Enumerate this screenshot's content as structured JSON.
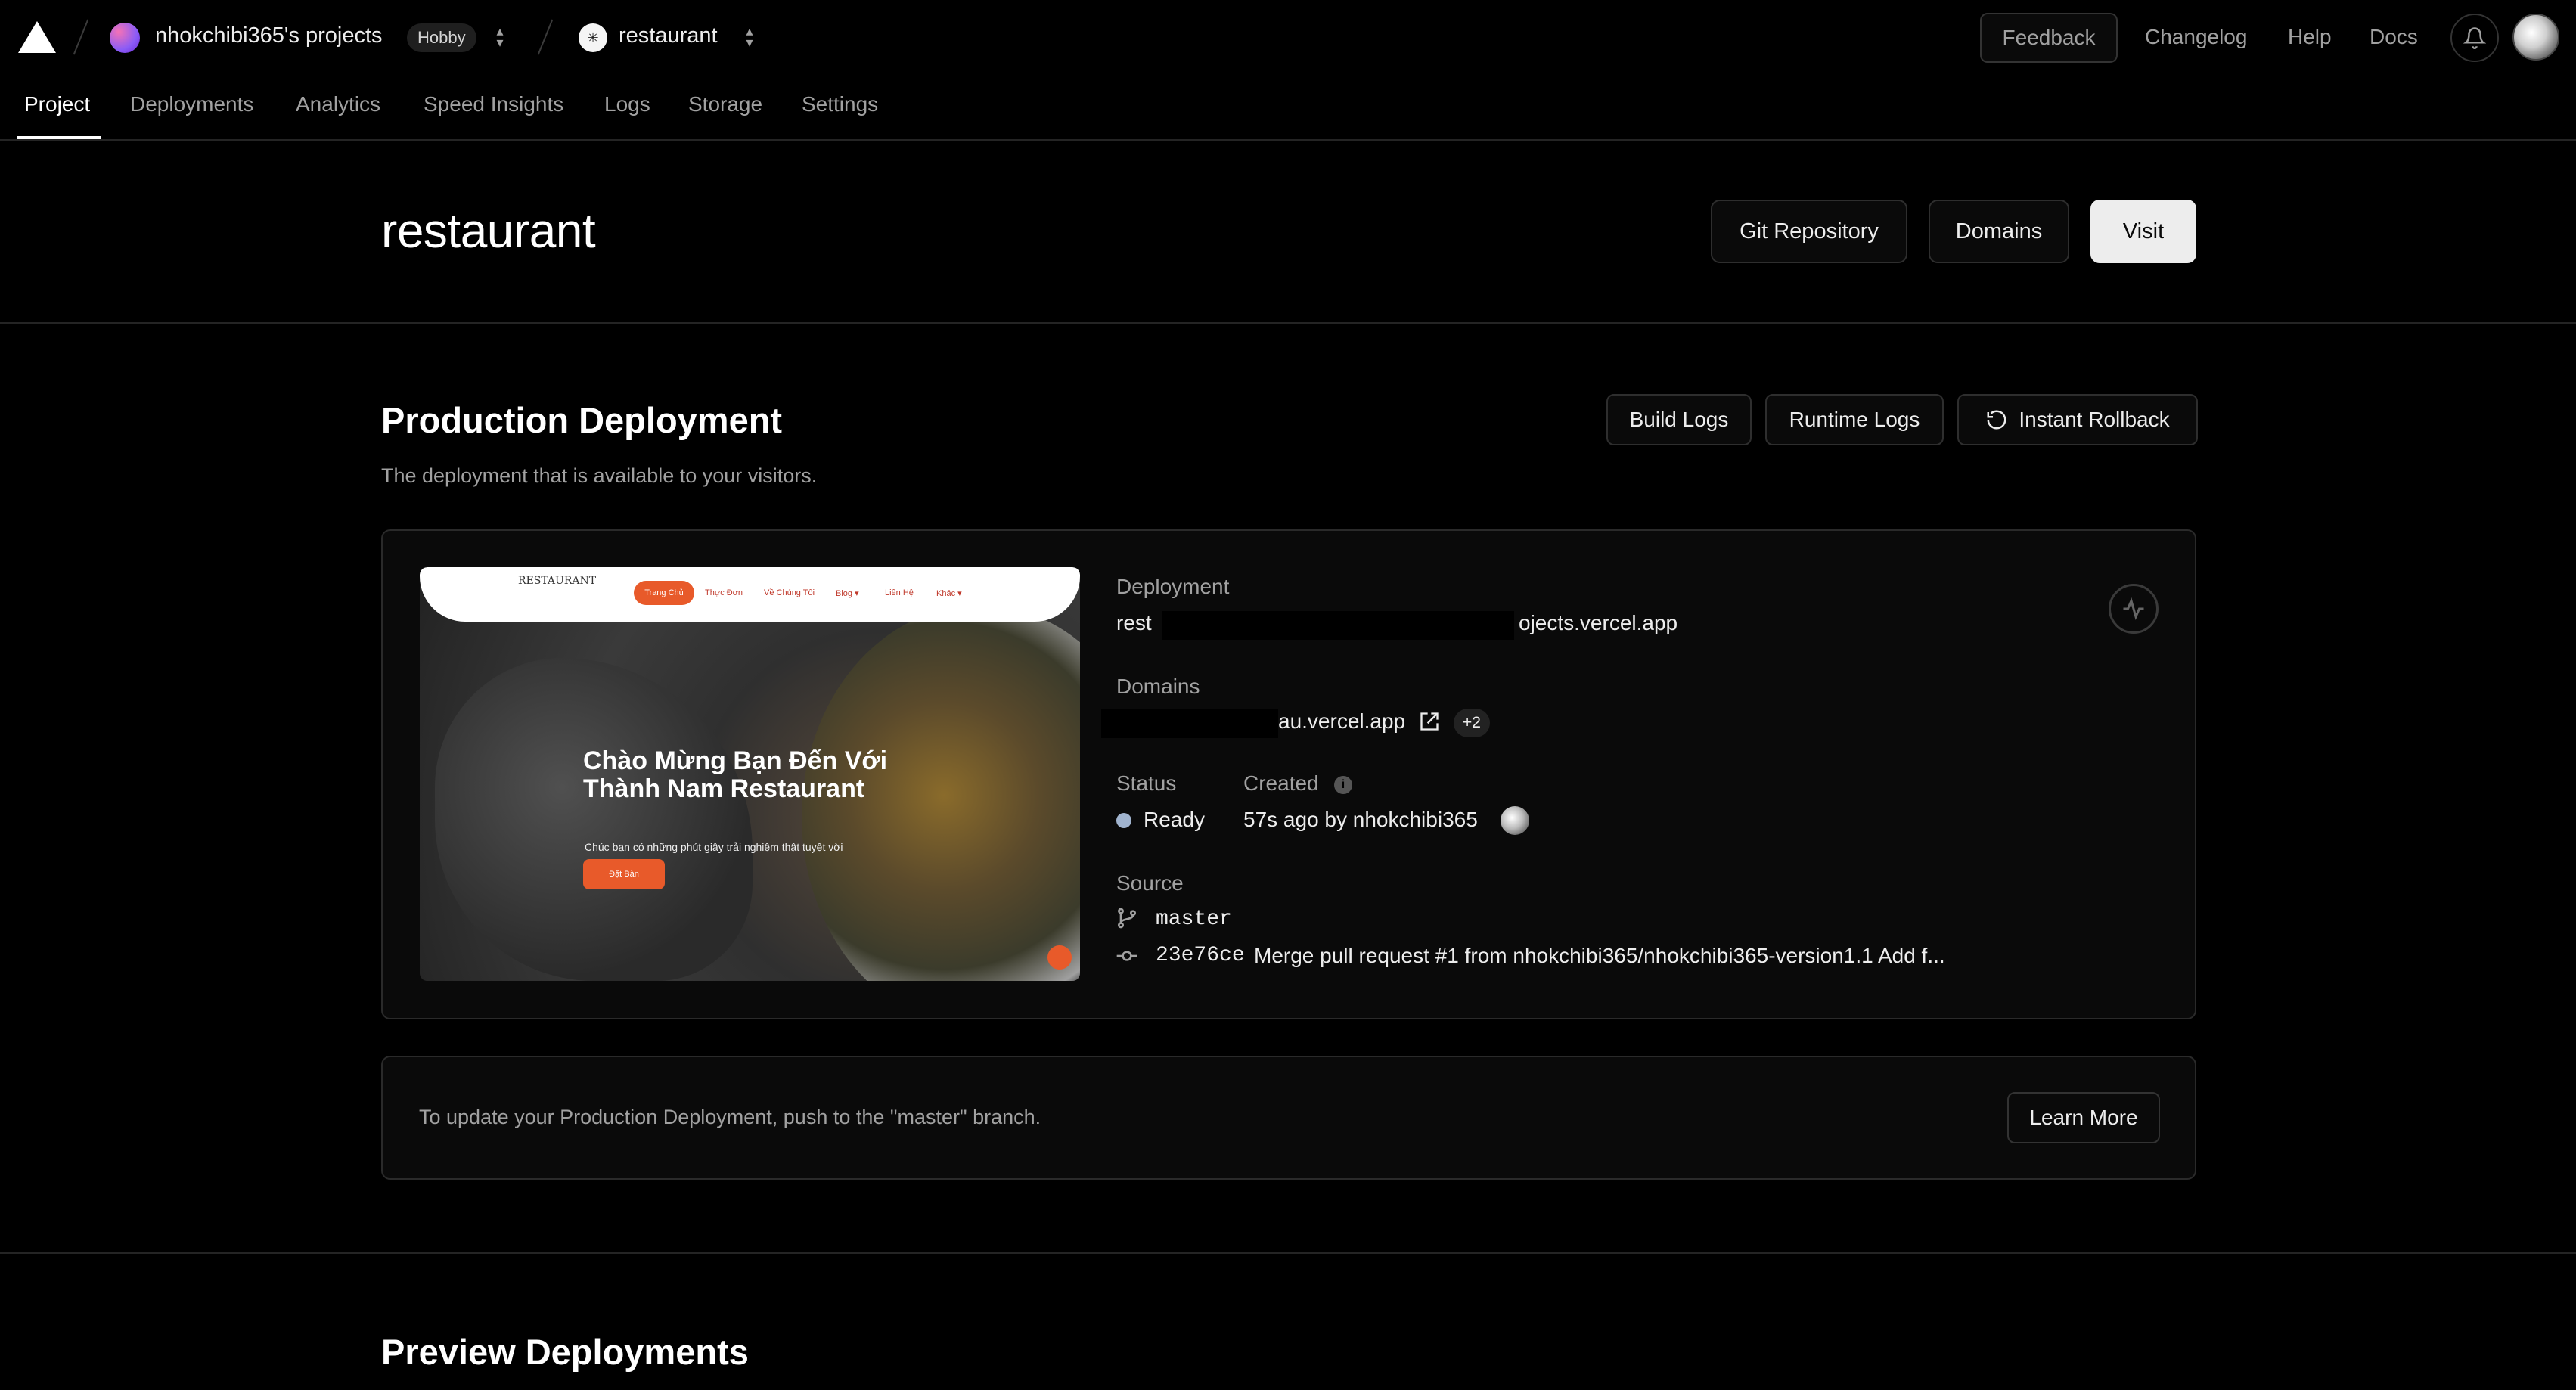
{
  "header": {
    "team_name": "nhokchibi365's projects",
    "plan_badge": "Hobby",
    "project_name": "restaurant",
    "feedback_label": "Feedback",
    "links": [
      "Changelog",
      "Help",
      "Docs"
    ]
  },
  "tabs": [
    {
      "label": "Project",
      "active": true
    },
    {
      "label": "Deployments",
      "active": false
    },
    {
      "label": "Analytics",
      "active": false
    },
    {
      "label": "Speed Insights",
      "active": false
    },
    {
      "label": "Logs",
      "active": false
    },
    {
      "label": "Storage",
      "active": false
    },
    {
      "label": "Settings",
      "active": false
    }
  ],
  "project": {
    "title": "restaurant",
    "buttons": {
      "git": "Git Repository",
      "domains": "Domains",
      "visit": "Visit"
    }
  },
  "production": {
    "heading": "Production Deployment",
    "subtitle": "The deployment that is available to your visitors.",
    "buttons": {
      "build_logs": "Build Logs",
      "runtime_logs": "Runtime Logs",
      "rollback": "Instant Rollback"
    },
    "preview": {
      "logo_text": "RESTAURANT",
      "nav": [
        "Trang Chủ",
        "Thực Đơn",
        "Về Chúng Tôi",
        "Blog ▾",
        "Liên Hệ",
        "Khác ▾"
      ],
      "headline": "Chào Mừng Bạn Đến Với Thành Nam Restaurant",
      "tagline": "Chúc bạn có những phút giây trải nghiệm thật tuyệt vời",
      "cta": "Đặt Bàn"
    },
    "deployment_label": "Deployment",
    "deployment_url_prefix": "rest",
    "deployment_url_suffix": "ojects.vercel.app",
    "domains_label": "Domains",
    "domain_suffix": "au.vercel.app",
    "domains_extra": "+2",
    "status_label": "Status",
    "status_value": "Ready",
    "status_color": "#a1b4cf",
    "created_label": "Created",
    "created_value": "57s ago by nhokchibi365",
    "source_label": "Source",
    "branch": "master",
    "commit_hash": "23e76ce",
    "commit_message": "Merge pull request #1 from nhokchibi365/nhokchibi365-version1.1 Add f..."
  },
  "update_notice": {
    "text": "To update your Production Deployment, push to the \"master\" branch.",
    "learn_more": "Learn More"
  },
  "preview_deployments": {
    "heading": "Preview Deployments"
  }
}
